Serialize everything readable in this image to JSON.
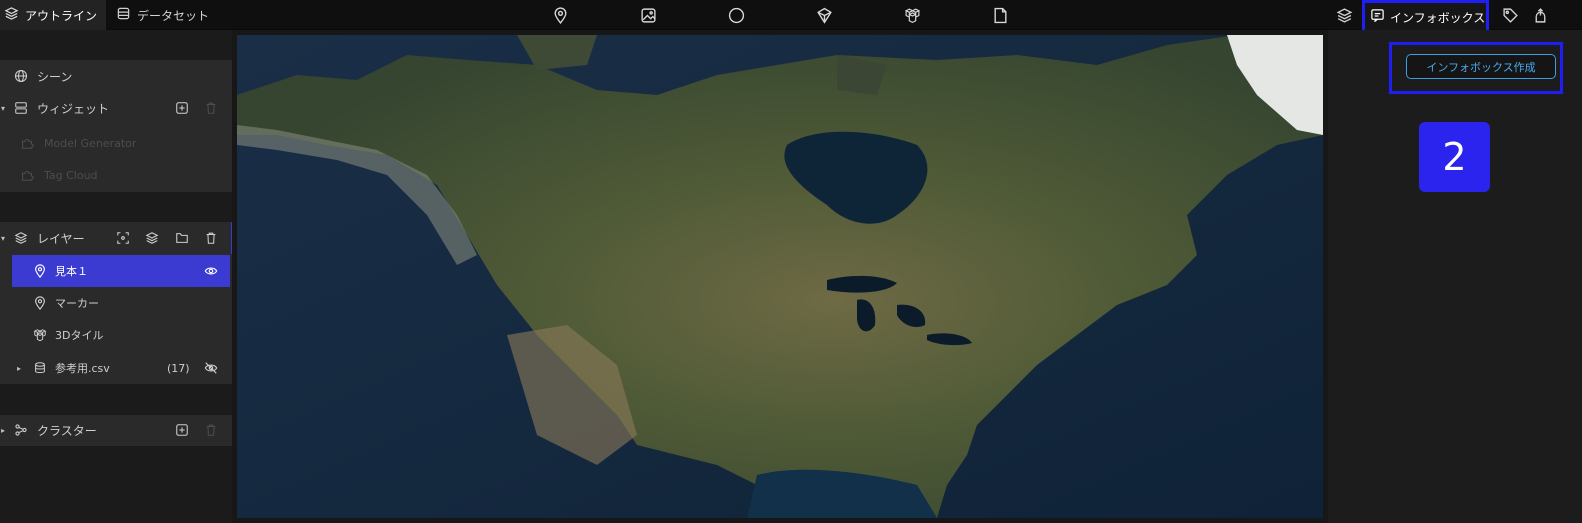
{
  "tabs": {
    "outline": "アウトライン",
    "dataset": "データセット",
    "infobox": "インフォボックス"
  },
  "sidebar": {
    "scene": "シーン",
    "widget": "ウィジェット",
    "widget_items": [
      "Model Generator",
      "Tag Cloud"
    ],
    "layer": "レイヤー",
    "layer_items": [
      {
        "label": "見本１",
        "selected": true
      },
      {
        "label": "マーカー"
      },
      {
        "label": "3Dタイル"
      },
      {
        "label": "参考用.csv",
        "count": "(17)"
      }
    ],
    "cluster": "クラスター"
  },
  "right_panel": {
    "create_button": "インフォボックス作成",
    "step_badge": "2"
  },
  "colors": {
    "accent": "#1f1ff5",
    "selected": "#3b3bd1",
    "button_text": "#48a9ef"
  },
  "icons": [
    "layers-icon",
    "database-icon",
    "location-pin-icon",
    "image-icon",
    "circle-icon",
    "box-icon",
    "tiles-icon",
    "file-icon",
    "infobox-icon",
    "tag-icon",
    "export-icon",
    "globe-icon",
    "widget-icon",
    "plus-icon",
    "trash-icon",
    "eye-icon",
    "eye-off-icon",
    "folder-icon",
    "focus-icon",
    "cluster-icon"
  ]
}
